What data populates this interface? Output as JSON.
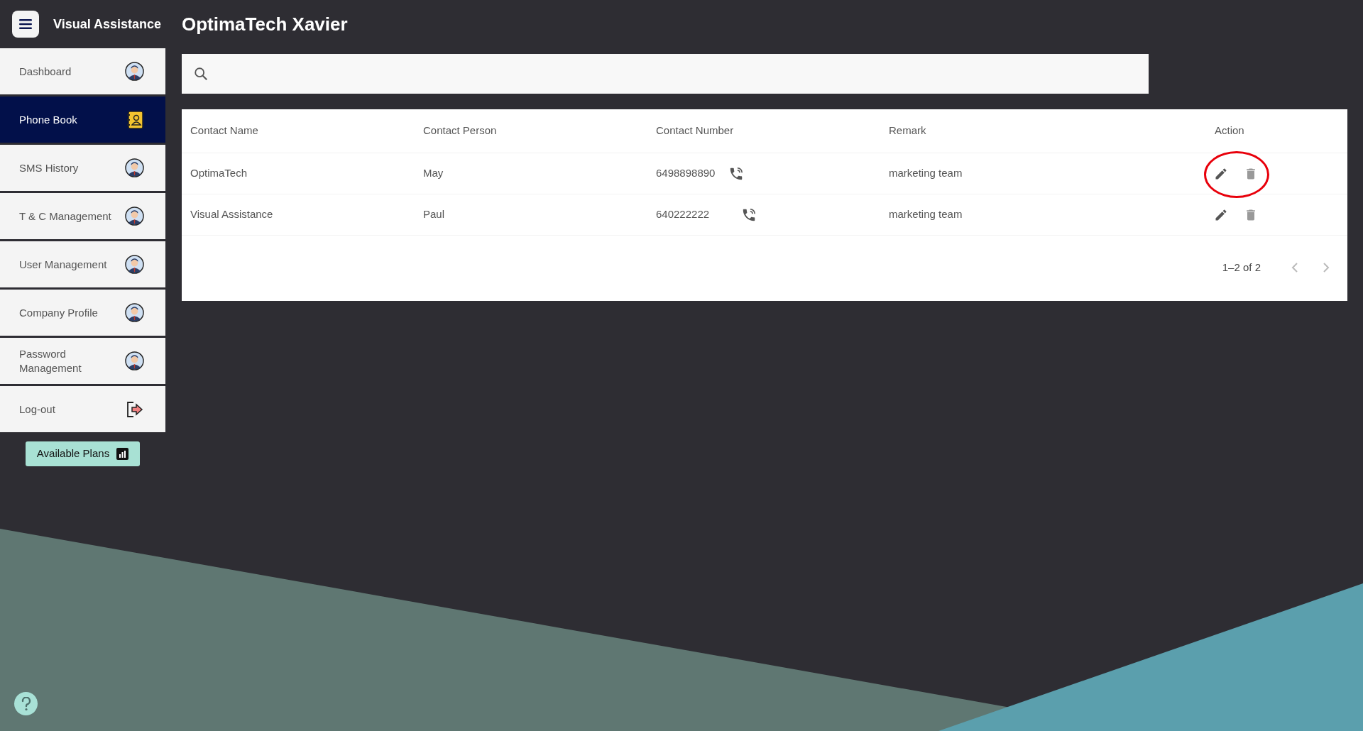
{
  "header": {
    "app_name": "Visual Assistance",
    "page_title": "OptimaTech Xavier"
  },
  "sidebar": {
    "items": [
      {
        "label": "Dashboard",
        "kind": "avatar",
        "selected": false
      },
      {
        "label": "Phone Book",
        "kind": "phonebook",
        "selected": true
      },
      {
        "label": "SMS History",
        "kind": "avatar",
        "selected": false
      },
      {
        "label": "T & C Management",
        "kind": "avatar",
        "selected": false
      },
      {
        "label": "User Management",
        "kind": "avatar",
        "selected": false
      },
      {
        "label": "Company Profile",
        "kind": "avatar",
        "selected": false
      },
      {
        "label": "Password Management",
        "kind": "avatar",
        "selected": false
      },
      {
        "label": "Log-out",
        "kind": "logout",
        "selected": false
      }
    ],
    "plans_button": "Available Plans"
  },
  "table": {
    "columns": [
      "Contact Name",
      "Contact Person",
      "Contact Number",
      "Remark",
      "Action"
    ],
    "rows": [
      {
        "contact_name": "OptimaTech",
        "contact_person": "May",
        "contact_number": "6498898890",
        "remark": "marketing team",
        "highlighted": true
      },
      {
        "contact_name": "Visual Assistance",
        "contact_person": "Paul",
        "contact_number": "640222222",
        "remark": "marketing team",
        "highlighted": false
      }
    ],
    "pagination": "1–2 of 2"
  }
}
